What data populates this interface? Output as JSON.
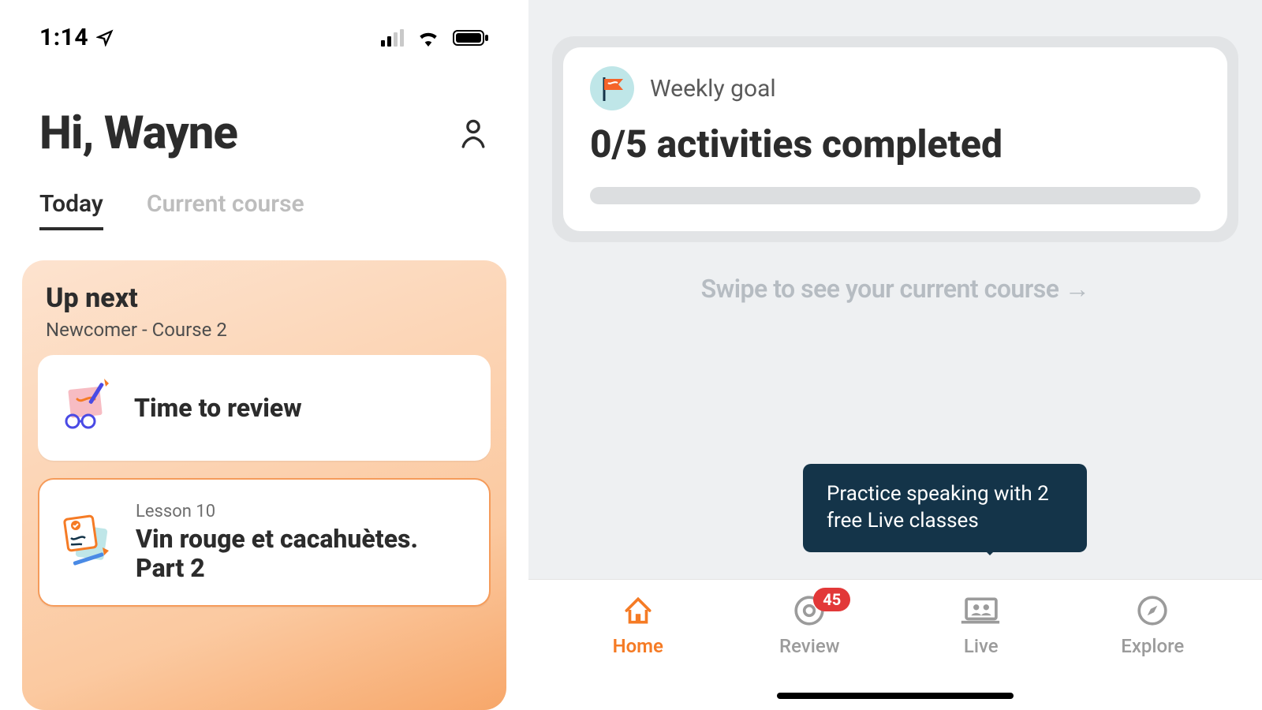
{
  "status_bar": {
    "time": "1:14"
  },
  "greeting": "Hi, Wayne",
  "tabs": {
    "today": "Today",
    "current_course": "Current course"
  },
  "upnext": {
    "heading": "Up next",
    "subtitle": "Newcomer - Course 2",
    "cards": [
      {
        "kicker": "",
        "title": "Time to review"
      },
      {
        "kicker": "Lesson 10",
        "title": "Vin rouge et cacahuètes. Part 2"
      }
    ]
  },
  "goal": {
    "label": "Weekly goal",
    "value": "0/5 activities completed"
  },
  "swipe_hint": "Swipe to see your current course →",
  "tooltip": "Practice speaking with 2 free Live classes",
  "tabbar": {
    "home": "Home",
    "review": "Review",
    "review_badge": "45",
    "live": "Live",
    "explore": "Explore"
  }
}
